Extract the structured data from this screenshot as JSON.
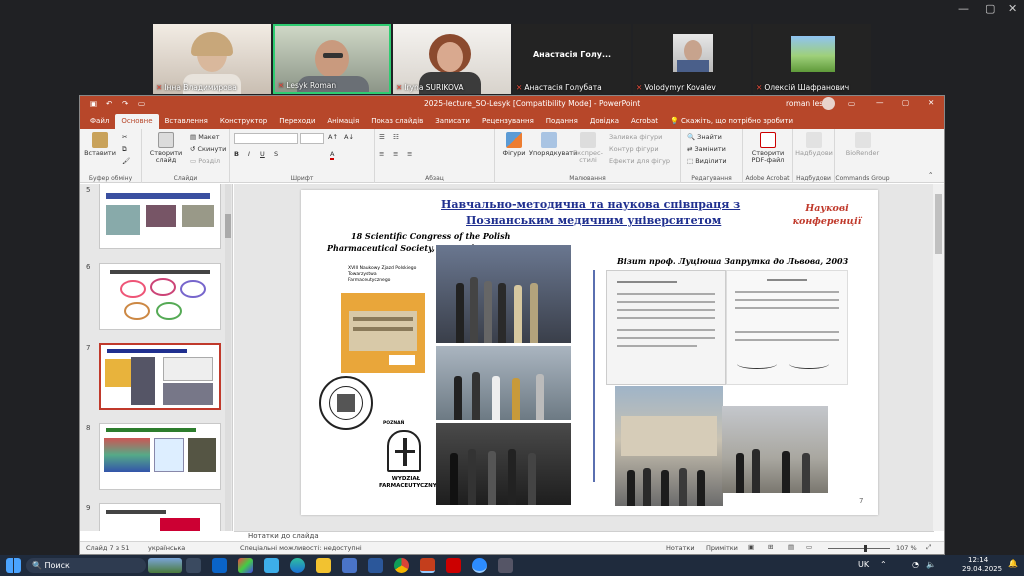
{
  "zoom": {
    "participants": [
      {
        "name": "Інна Владимирова"
      },
      {
        "name": "Lesyk Roman"
      },
      {
        "name": "Iryna SURIKOVA"
      },
      {
        "name": "Анастасія Голубата",
        "tile_label": "Анастасія Голу..."
      },
      {
        "name": "Volodymyr Kovalev"
      },
      {
        "name": "Олексій Шафранович"
      }
    ]
  },
  "ppt": {
    "title": "2025-lecture_SO-Lesyk [Compatibility Mode] - PowerPoint",
    "user": "roman lesyk",
    "tabs": [
      "Файл",
      "Основне",
      "Вставлення",
      "Конструктор",
      "Переходи",
      "Анімація",
      "Показ слайдів",
      "Записати",
      "Рецензування",
      "Подання",
      "Довідка",
      "Acrobat"
    ],
    "active_tab": "Основне",
    "tellme": "Скажіть, що потрібно зробити",
    "ribbon": {
      "paste": "Вставити",
      "clipboard": "Буфер обміну",
      "new_slide": "Створити слайд",
      "layout": "Макет",
      "reset": "Скинути",
      "section": "Розділ",
      "slides": "Слайди",
      "font": "Шрифт",
      "paragraph": "Абзац",
      "shapes": "Фігури",
      "arrange": "Упорядкувати",
      "styles": "Експрес-стилі",
      "fill": "Заливка фігури",
      "outline": "Контур фігури",
      "effects": "Ефекти для фігур",
      "drawing": "Малювання",
      "find": "Знайти",
      "replace": "Замінити",
      "select": "Виділити",
      "editing": "Редагування",
      "create_pdf": "Створити PDF-файл",
      "adobe": "Adobe Acrobat",
      "nadbudovy_btn": "Надбудови",
      "nadbudovy": "Надбудови",
      "biorender": "BioRender",
      "commands": "Commands Group"
    },
    "thumb_numbers": [
      "5",
      "6",
      "7",
      "8",
      "9"
    ],
    "slide": {
      "heading_line1": "Навчально-методична та наукова співпраця з",
      "heading_line2": "Познанським медичним університетом",
      "side_title": "Наукові конференції",
      "congress_line1": "18 Scientific Congress of the Polish",
      "congress_line2": "Pharmaceutical Society, September 19-22, 2001",
      "visit": "Візит проф. Луціюша Запрутка до Львова, 2003",
      "congress_box_title": "XVIII Naukowy Zjazd Polskiego Towarzystwa Farmaceutycznego",
      "poznan": "POZNAŃ",
      "wydzial": "WYDZIAŁ FARMACEUTYCZNY",
      "page_num": "7"
    },
    "notes": "Нотатки до слайда",
    "status": {
      "slide_info": "Слайд 7 з 51",
      "language": "українська",
      "accessibility": "Спеціальні можливості: недоступні",
      "notes_btn": "Нотатки",
      "comments_btn": "Примітки",
      "zoom": "107 %"
    }
  },
  "taskbar": {
    "search": "Поиск",
    "lang": "UK",
    "time": "12:14",
    "date": "29.04.2025"
  },
  "colors": {
    "accent": "#b7472a",
    "heading": "#1f2f8f",
    "red_title": "#c0392b"
  }
}
